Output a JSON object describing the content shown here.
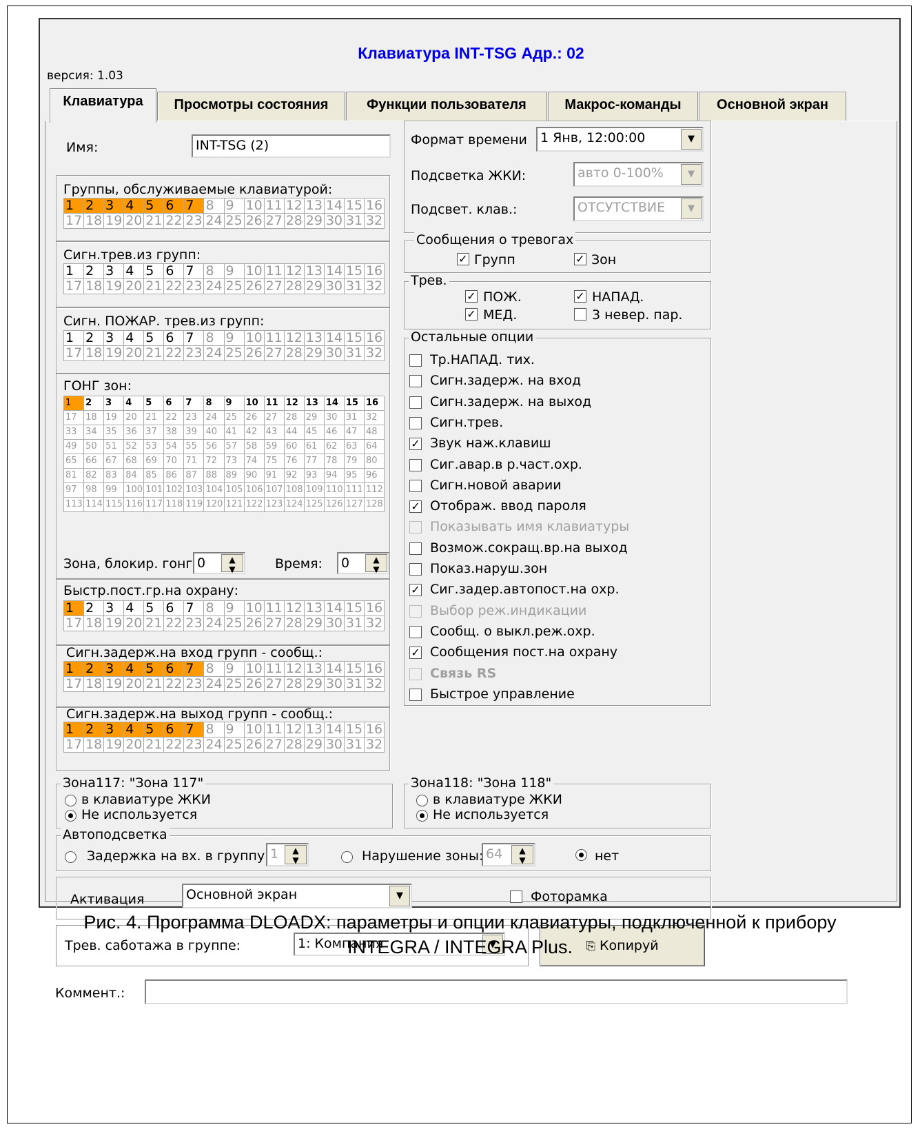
{
  "window": {
    "title": "Клавиатура INT-TSG Адр.: 02",
    "version": "версия: 1.03"
  },
  "tabs": [
    "Клавиатура",
    "Просмотры состояния",
    "Функции пользователя",
    "Макрос-команды",
    "Основной экран"
  ],
  "name": {
    "label": "Имя:",
    "value": "INT-TSG    (2)"
  },
  "groups_served": {
    "label": "Группы, обслуживаемые клавиатурой:",
    "selected": [
      1,
      2,
      3,
      4,
      5,
      6,
      7
    ],
    "enabled": []
  },
  "alarm_groups": {
    "label": "Сигн.трев.из групп:",
    "selected": [],
    "enabled": [
      1,
      2,
      3,
      4,
      5,
      6,
      7
    ]
  },
  "fire_groups": {
    "label": "Сигн. ПОЖАР. трев.из групп:",
    "selected": [],
    "enabled": [
      1,
      2,
      3,
      4,
      5,
      6,
      7
    ]
  },
  "gong": {
    "label": "ГОНГ зон:",
    "selected": [
      1
    ],
    "enabled": [
      2,
      3,
      4,
      5,
      6,
      7,
      8,
      9,
      10,
      11,
      12,
      13,
      14,
      15,
      16
    ]
  },
  "gong_block": {
    "label": "Зона, блокир. гонг:",
    "value": "0",
    "time_label": "Время:",
    "time_value": "0"
  },
  "quick_arm": {
    "label": "Быстр.пост.гр.на охрану:",
    "selected": [
      1
    ],
    "enabled": [
      2,
      3,
      4,
      5,
      6,
      7
    ]
  },
  "entry_delay": {
    "label": "Сигн.задерж.на вход групп - сообщ.:",
    "selected": [
      1,
      2,
      3,
      4,
      5,
      6,
      7
    ],
    "enabled": []
  },
  "exit_delay": {
    "label": "Сигн.задерж.на выход групп - сообщ.:",
    "selected": [
      1,
      2,
      3,
      4,
      5,
      6,
      7
    ],
    "enabled": []
  },
  "time_format": {
    "label": "Формат времени",
    "value": "1 Янв, 12:00:00"
  },
  "lcd_backlight": {
    "label": "Подсветка ЖКИ:",
    "value": "авто 0-100%"
  },
  "key_backlight": {
    "label": "Подсвет. клав.:",
    "value": "ОТСУТСТВИЕ"
  },
  "alarm_messages": {
    "title": "Сообщения о тревогах",
    "groups": "Групп",
    "zones": "Зон"
  },
  "alarms": {
    "title": "Трев.",
    "fire": "ПОЖ.",
    "panic": "НАПАД.",
    "medical": "МЕД.",
    "wrong_code": "3 невер. пар."
  },
  "other_options": {
    "title": "Остальные опции",
    "items": [
      {
        "label": "Тр.НАПАД. тих.",
        "checked": false,
        "disabled": false,
        "bold": false
      },
      {
        "label": "Сигн.задерж. на вход",
        "checked": false,
        "disabled": false,
        "bold": false
      },
      {
        "label": "Сигн.задерж. на выход",
        "checked": false,
        "disabled": false,
        "bold": false
      },
      {
        "label": "Сигн.трев.",
        "checked": false,
        "disabled": false,
        "bold": false
      },
      {
        "label": "Звук наж.клавиш",
        "checked": true,
        "disabled": false,
        "bold": false
      },
      {
        "label": "Сиг.авар.в р.част.охр.",
        "checked": false,
        "disabled": false,
        "bold": false
      },
      {
        "label": "Сигн.новой аварии",
        "checked": false,
        "disabled": false,
        "bold": false
      },
      {
        "label": "Отображ. ввод пароля",
        "checked": true,
        "disabled": false,
        "bold": false
      },
      {
        "label": "Показывать имя клавиатуры",
        "checked": false,
        "disabled": true,
        "bold": false
      },
      {
        "label": "Возмож.сокращ.вр.на выход",
        "checked": false,
        "disabled": false,
        "bold": false
      },
      {
        "label": "Показ.наруш.зон",
        "checked": false,
        "disabled": false,
        "bold": false
      },
      {
        "label": "Сиг.задер.автопост.на охр.",
        "checked": true,
        "disabled": false,
        "bold": false
      },
      {
        "label": "Выбор реж.индикации",
        "checked": false,
        "disabled": true,
        "bold": false
      },
      {
        "label": "Сообщ. о выкл.реж.охр.",
        "checked": false,
        "disabled": false,
        "bold": false
      },
      {
        "label": "Сообщения пост.на охрану",
        "checked": true,
        "disabled": false,
        "bold": false
      },
      {
        "label": "Связь RS",
        "checked": false,
        "disabled": true,
        "bold": true
      },
      {
        "label": "Быстрое управление",
        "checked": false,
        "disabled": false,
        "bold": false
      }
    ]
  },
  "zone117": {
    "title": "Зона117: \"Зона 117\"",
    "opt1": "в клавиатуре ЖКИ",
    "opt2": "Не используется"
  },
  "zone118": {
    "title": "Зона118: \"Зона 118\"",
    "opt1": "в клавиатуре ЖКИ",
    "opt2": "Не используется"
  },
  "autobacklight": {
    "title": "Автоподсветка",
    "delay_label": "Задержка на вх. в группу:",
    "delay_value": "1",
    "zone_label": "Нарушение зоны:",
    "zone_value": "64",
    "none_label": "нет"
  },
  "activation": {
    "label": "Активация",
    "value": "Основной экран",
    "photoframe": "Фоторамка"
  },
  "tamper": {
    "label": "Трев. саботажа в группе:",
    "value": "1: Компания",
    "copy": "Копируй"
  },
  "comment": {
    "label": "Коммент.:",
    "value": ""
  },
  "caption": {
    "line1": "Рис. 4. Программа DLOADX: параметры и опции клавиатуры, подключенной к прибору",
    "line2": "INTEGRA / INTEGRA Plus."
  },
  "colors": {
    "selected": "#ff9900",
    "title": "#0000e0"
  }
}
